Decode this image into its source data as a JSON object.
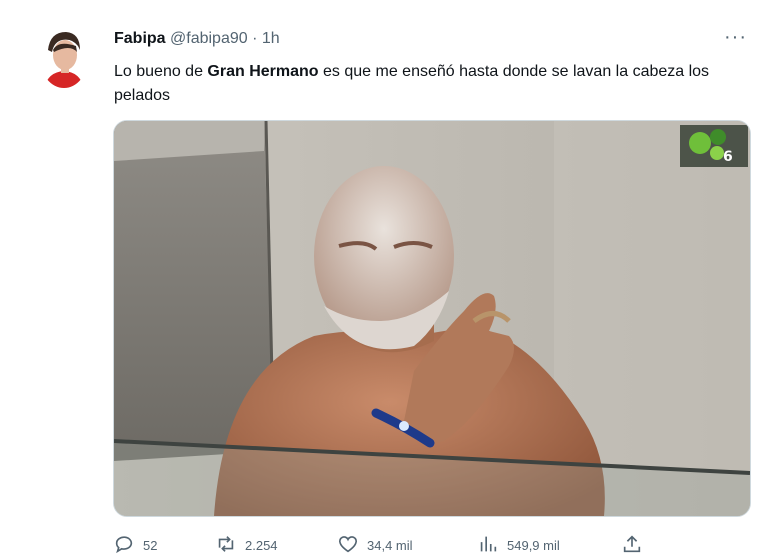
{
  "tweet": {
    "author_name": "Fabipa",
    "handle": "@fabipa90",
    "separator": "·",
    "time": "1h",
    "more_label": "···",
    "text_before": "Lo bueno de ",
    "text_bold": "Gran Hermano",
    "text_after": " es que me enseñó hasta donde se lavan la cabeza los pelados"
  },
  "actions": {
    "replies": "52",
    "retweets": "2.254",
    "likes": "34,4 mil",
    "views": "549,9 mil"
  },
  "media": {
    "channel_badge": "6"
  },
  "icons": [
    "reply-icon",
    "retweet-icon",
    "like-icon",
    "views-icon",
    "share-icon"
  ],
  "colors": {
    "text": "#0f1419",
    "secondary": "#536471",
    "border": "#cfd9de"
  }
}
